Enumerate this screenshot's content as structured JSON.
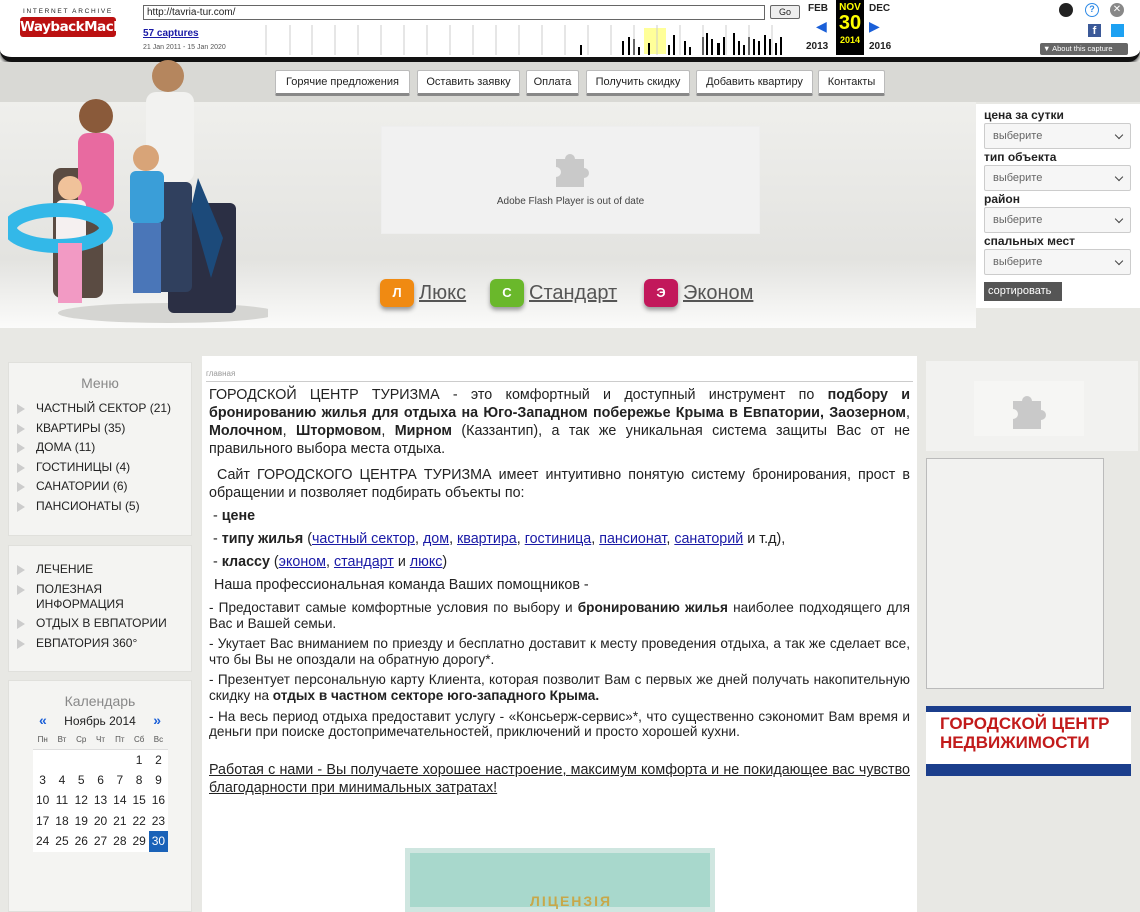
{
  "wayback": {
    "logo_top": "INTERNET ARCHIVE",
    "logo_main": "WaybackMachine",
    "url": "http://tavria-tur.com/",
    "go": "Go",
    "captures": "57 captures",
    "range": "21 Jan 2011 - 15 Jan 2020",
    "prev_month": "FEB",
    "cur_month": "NOV",
    "next_month": "DEC",
    "day": "30",
    "prev_year": "2013",
    "cur_year": "2014",
    "next_year": "2016",
    "about": "About this capture"
  },
  "nav": [
    "Горячие предложения",
    "Оставить заявку",
    "Оплата",
    "Получить скидку",
    "Добавить квартиру",
    "Контакты"
  ],
  "flash_text": "Adobe Flash Player is out of date",
  "categories": [
    {
      "badge": "Л",
      "label": "Люкс",
      "color": "#f08a12"
    },
    {
      "badge": "С",
      "label": "Стандарт",
      "color": "#6ab82b"
    },
    {
      "badge": "Э",
      "label": "Эконом",
      "color": "#c2185b"
    }
  ],
  "filters": {
    "labels": [
      "цена за сутки",
      "тип объекта",
      "район",
      "спальных мест"
    ],
    "placeholder": "выберите",
    "sort": "сортировать"
  },
  "menu": {
    "title": "Меню",
    "items": [
      "ЧАСТНЫЙ СЕКТОР (21)",
      "КВАРТИРЫ (35)",
      "ДОМА (11)",
      "ГОСТИНИЦЫ (4)",
      "САНАТОРИИ (6)",
      "ПАНСИОНАТЫ (5)"
    ],
    "items2": [
      "ЛЕЧЕНИЕ",
      "ПОЛЕЗНАЯ ИНФОРМАЦИЯ",
      "ОТДЫХ В ЕВПАТОРИИ",
      "ЕВПАТОРИЯ 360°"
    ]
  },
  "calendar": {
    "title": "Календарь",
    "month": "Ноябрь 2014",
    "prev": "«",
    "next": "»",
    "weekdays": [
      "Пн",
      "Вт",
      "Ср",
      "Чт",
      "Пт",
      "Сб",
      "Вс"
    ],
    "weeks": [
      [
        "",
        "",
        "",
        "",
        "",
        "1",
        "2"
      ],
      [
        "3",
        "4",
        "5",
        "6",
        "7",
        "8",
        "9"
      ],
      [
        "10",
        "11",
        "12",
        "13",
        "14",
        "15",
        "16"
      ],
      [
        "17",
        "18",
        "19",
        "20",
        "21",
        "22",
        "23"
      ],
      [
        "24",
        "25",
        "26",
        "27",
        "28",
        "29",
        "30"
      ]
    ],
    "today": "30"
  },
  "content": {
    "crumb": "главная",
    "p1a": "ГОРОДСКОЙ ЦЕНТР ТУРИЗМА - это комфортный и доступный инструмент по ",
    "p1b": "подбору и бронированию жилья для отдыха на Юго-Западном побережье Крыма в Евпатории, Заозерном",
    "p1c": ", ",
    "p1d": "Молочном",
    "p1e": ", ",
    "p1f": "Штормовом",
    "p1g": ", ",
    "p1h": "Мирном",
    "p1i": " (Каззантип), а так же уникальная система защиты Вас от не правильного выбора места отдыха.",
    "p2": "Сайт ГОРОДСКОГО ЦЕНТРА ТУРИЗМА имеет интуитивно понятую систему бронирования, прост в обращении и позволяет подбирать объекты по:",
    "b1": "цене",
    "b2": "типу жилья",
    "b2links": [
      "частный сектор",
      "дом",
      "квартира",
      "гостиница",
      "пансионат",
      "санаторий"
    ],
    "b2tail": " и т.д),",
    "b3": "классу",
    "b3links": [
      "эконом",
      "стандарт",
      "люкс"
    ],
    "b3and": " и ",
    "team": "Наша профессиональная команда Ваших помощников -",
    "s1a": "- Предоставит самые комфортные условия по выбору и ",
    "s1b": "бронированию жилья",
    "s1c": " наиболее подходящего для Вас и Вашей семьи.",
    "s2": "- Укутает Вас вниманием по приезду и бесплатно доставит к месту проведения отдыха, а так же сделает все, что бы Вы не опоздали на обратную дорогу*.",
    "s3a": "- Презентует персональную карту Клиента, которая позволит Вам с первых же дней получать накопительную скидку на ",
    "s3b": "отдых в частном секторе юго-западного Крыма.",
    "s4": "- На весь период отдыха предоставит услугу - «Консьерж-сервис»*, что существенно сэкономит Вам время и деньги при поиске достопримечательностей, приключений и просто хорошей кухни.",
    "footer": "Работая с нами - Вы получаете хорошее настроение, максимум комфорта и не покидающее вас чувство благодарности при минимальных затратах!"
  },
  "banner": {
    "line1": "ГОРОДСКОЙ ЦЕНТР",
    "line2": "НЕДВИЖИМОСТИ"
  },
  "license": "ЛІЦЕНЗІЯ"
}
